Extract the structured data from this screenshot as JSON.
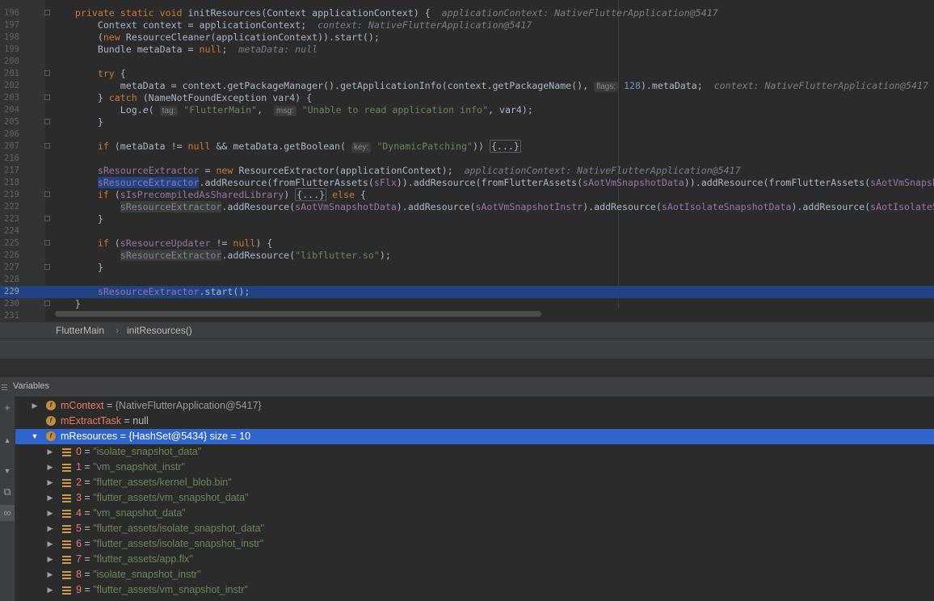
{
  "editor": {
    "lines": [
      {
        "num": "196",
        "segments": [
          {
            "t": "    "
          },
          {
            "t": "private static void ",
            "c": "kw"
          },
          {
            "t": "initResources(Context applicationContext) {  "
          },
          {
            "t": "applicationContext: NativeFlutterApplication@5417",
            "c": "inl"
          }
        ]
      },
      {
        "num": "197",
        "segments": [
          {
            "t": "        Context context = applicationContext;  "
          },
          {
            "t": "context: NativeFlutterApplication@5417",
            "c": "inl"
          }
        ]
      },
      {
        "num": "198",
        "segments": [
          {
            "t": "        ("
          },
          {
            "t": "new ",
            "c": "kw"
          },
          {
            "t": "ResourceCleaner(applicationContext)).start();"
          }
        ]
      },
      {
        "num": "199",
        "segments": [
          {
            "t": "        Bundle metaData = "
          },
          {
            "t": "null",
            "c": "kw"
          },
          {
            "t": ";  "
          },
          {
            "t": "metaData: null",
            "c": "inl"
          }
        ]
      },
      {
        "num": "200",
        "segments": []
      },
      {
        "num": "201",
        "segments": [
          {
            "t": "        "
          },
          {
            "t": "try ",
            "c": "kw"
          },
          {
            "t": "{"
          }
        ]
      },
      {
        "num": "202",
        "segments": [
          {
            "t": "            metaData = context.getPackageManager().getApplicationInfo(context.getPackageName(), "
          },
          {
            "t": "flags:",
            "c": "hint"
          },
          {
            "t": " "
          },
          {
            "t": "128",
            "c": "num"
          },
          {
            "t": ").metaData;  "
          },
          {
            "t": "context: NativeFlutterApplication@5417",
            "c": "inl"
          }
        ]
      },
      {
        "num": "203",
        "segments": [
          {
            "t": "        } "
          },
          {
            "t": "catch ",
            "c": "kw"
          },
          {
            "t": "(NameNotFoundException var4) {"
          }
        ]
      },
      {
        "num": "204",
        "segments": [
          {
            "t": "            Log."
          },
          {
            "t": "e",
            "c": "it"
          },
          {
            "t": "( "
          },
          {
            "t": "tag:",
            "c": "hint"
          },
          {
            "t": " "
          },
          {
            "t": "\"FlutterMain\"",
            "c": "str"
          },
          {
            "t": ",  "
          },
          {
            "t": "msg:",
            "c": "hint"
          },
          {
            "t": " "
          },
          {
            "t": "\"Unable to read application info\"",
            "c": "str"
          },
          {
            "t": ", var4);"
          }
        ]
      },
      {
        "num": "205",
        "segments": [
          {
            "t": "        }"
          }
        ]
      },
      {
        "num": "206",
        "segments": []
      },
      {
        "num": "207",
        "segments": [
          {
            "t": "        "
          },
          {
            "t": "if ",
            "c": "kw"
          },
          {
            "t": "(metaData != "
          },
          {
            "t": "null ",
            "c": "kw"
          },
          {
            "t": "&& metaData.getBoolean( "
          },
          {
            "t": "key:",
            "c": "hint"
          },
          {
            "t": " "
          },
          {
            "t": "\"DynamicPatching\"",
            "c": "str"
          },
          {
            "t": ")) "
          },
          {
            "t": "{...}",
            "c": "foldbox"
          }
        ]
      },
      {
        "num": "216",
        "segments": []
      },
      {
        "num": "217",
        "segments": [
          {
            "t": "        "
          },
          {
            "t": "sResourceExtractor",
            "c": "fieldref"
          },
          {
            "t": " = "
          },
          {
            "t": "new ",
            "c": "kw"
          },
          {
            "t": "ResourceExtractor(applicationContext);  "
          },
          {
            "t": "applicationContext: NativeFlutterApplication@5417",
            "c": "inl"
          }
        ]
      },
      {
        "num": "218",
        "segments": [
          {
            "t": "        "
          },
          {
            "t": "sResourceExtractor",
            "c": "fieldref sel"
          },
          {
            "t": ".addResource(fromFlutterAssets("
          },
          {
            "t": "sFlx",
            "c": "fieldref"
          },
          {
            "t": ")).addResource(fromFlutterAssets("
          },
          {
            "t": "sAotVmSnapshotData",
            "c": "fieldref"
          },
          {
            "t": ")).addResource(fromFlutterAssets("
          },
          {
            "t": "sAotVmSnapshotInstr",
            "c": "fieldref"
          },
          {
            "t": "))"
          }
        ]
      },
      {
        "num": "219",
        "segments": [
          {
            "t": "        "
          },
          {
            "t": "if ",
            "c": "kw"
          },
          {
            "t": "("
          },
          {
            "t": "sIsPrecompiledAsSharedLibrary",
            "c": "fieldref"
          },
          {
            "t": ") "
          },
          {
            "t": "{...}",
            "c": "foldbox"
          },
          {
            "t": " "
          },
          {
            "t": "else ",
            "c": "kw"
          },
          {
            "t": "{"
          }
        ]
      },
      {
        "num": "222",
        "segments": [
          {
            "t": "            "
          },
          {
            "t": "sResourceExtractor",
            "c": "fieldref hl"
          },
          {
            "t": ".addResource("
          },
          {
            "t": "sAotVmSnapshotData",
            "c": "fieldref"
          },
          {
            "t": ").addResource("
          },
          {
            "t": "sAotVmSnapshotInstr",
            "c": "fieldref"
          },
          {
            "t": ").addResource("
          },
          {
            "t": "sAotIsolateSnapshotData",
            "c": "fieldref"
          },
          {
            "t": ").addResource("
          },
          {
            "t": "sAotIsolateSnapshotInstr",
            "c": "fieldref"
          },
          {
            "t": ")"
          }
        ]
      },
      {
        "num": "223",
        "segments": [
          {
            "t": "        }"
          }
        ]
      },
      {
        "num": "224",
        "segments": []
      },
      {
        "num": "225",
        "segments": [
          {
            "t": "        "
          },
          {
            "t": "if ",
            "c": "kw"
          },
          {
            "t": "("
          },
          {
            "t": "sResourceUpdater",
            "c": "fieldref"
          },
          {
            "t": " != "
          },
          {
            "t": "null",
            "c": "kw"
          },
          {
            "t": ") {"
          }
        ]
      },
      {
        "num": "226",
        "segments": [
          {
            "t": "            "
          },
          {
            "t": "sResourceExtractor",
            "c": "fieldref hl"
          },
          {
            "t": ".addResource("
          },
          {
            "t": "\"libflutter.so\"",
            "c": "str"
          },
          {
            "t": ");"
          }
        ]
      },
      {
        "num": "227",
        "segments": [
          {
            "t": "        }"
          }
        ]
      },
      {
        "num": "228",
        "segments": []
      },
      {
        "num": "229",
        "selected": true,
        "segments": [
          {
            "t": "        "
          },
          {
            "t": "sResourceExtractor",
            "c": "fieldref"
          },
          {
            "t": ".start();"
          }
        ]
      },
      {
        "num": "230",
        "segments": [
          {
            "t": "    }"
          }
        ]
      },
      {
        "num": "231",
        "segments": []
      }
    ]
  },
  "breadcrumb": {
    "class_name": "FlutterMain",
    "separator": "›",
    "method_name": "initResources()"
  },
  "variables_panel": {
    "title": "Variables",
    "tools": [
      "+",
      "▲",
      "▼",
      "⧉",
      "∞"
    ],
    "rows": [
      {
        "expand": "▶",
        "icon": "f",
        "name": "mContext",
        "eq": " = ",
        "value": "{NativeFlutterApplication@5417}",
        "vstyle": "valgray",
        "indent": 0
      },
      {
        "expand": "",
        "icon": "f",
        "name": "mExtractTask",
        "eq": " = ",
        "value": "null",
        "vstyle": "valplain",
        "indent": 0
      },
      {
        "expand": "▼",
        "icon": "f",
        "name": "mResources",
        "eq": " = ",
        "value": "{HashSet@5434}  size = 10",
        "vstyle": "valplain",
        "indent": 0,
        "selected": true
      },
      {
        "expand": "▶",
        "icon": "arr",
        "name": "0",
        "eq": " = ",
        "value": "\"isolate_snapshot_data\"",
        "vstyle": "valstr",
        "indent": 1
      },
      {
        "expand": "▶",
        "icon": "arr",
        "name": "1",
        "eq": " = ",
        "value": "\"vm_snapshot_instr\"",
        "vstyle": "valstr",
        "indent": 1
      },
      {
        "expand": "▶",
        "icon": "arr",
        "name": "2",
        "eq": " = ",
        "value": "\"flutter_assets/kernel_blob.bin\"",
        "vstyle": "valstr",
        "indent": 1
      },
      {
        "expand": "▶",
        "icon": "arr",
        "name": "3",
        "eq": " = ",
        "value": "\"flutter_assets/vm_snapshot_data\"",
        "vstyle": "valstr",
        "indent": 1
      },
      {
        "expand": "▶",
        "icon": "arr",
        "name": "4",
        "eq": " = ",
        "value": "\"vm_snapshot_data\"",
        "vstyle": "valstr",
        "indent": 1
      },
      {
        "expand": "▶",
        "icon": "arr",
        "name": "5",
        "eq": " = ",
        "value": "\"flutter_assets/isolate_snapshot_data\"",
        "vstyle": "valstr",
        "indent": 1
      },
      {
        "expand": "▶",
        "icon": "arr",
        "name": "6",
        "eq": " = ",
        "value": "\"flutter_assets/isolate_snapshot_instr\"",
        "vstyle": "valstr",
        "indent": 1
      },
      {
        "expand": "▶",
        "icon": "arr",
        "name": "7",
        "eq": " = ",
        "value": "\"flutter_assets/app.flx\"",
        "vstyle": "valstr",
        "indent": 1
      },
      {
        "expand": "▶",
        "icon": "arr",
        "name": "8",
        "eq": " = ",
        "value": "\"isolate_snapshot_instr\"",
        "vstyle": "valstr",
        "indent": 1
      },
      {
        "expand": "▶",
        "icon": "arr",
        "name": "9",
        "eq": " = ",
        "value": "\"flutter_assets/vm_snapshot_instr\"",
        "vstyle": "valstr",
        "indent": 1
      }
    ]
  },
  "colors": {
    "selection_blue": "#2f65ca",
    "editor_selection": "#214283",
    "keyword": "#cc7832",
    "string": "#6a8759",
    "field": "#9876aa"
  }
}
